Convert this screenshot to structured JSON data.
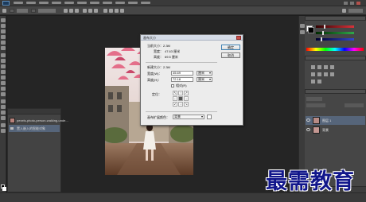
{
  "menubar": {
    "app_icon": "photoshop-logo-icon",
    "menu_count": 11
  },
  "dialog": {
    "title": "画布大小",
    "current_size_label": "当前大小：2.3M",
    "current_width_label": "宽度：",
    "current_width_value": "47.63 厘米",
    "current_height_label": "高度：",
    "current_height_value": "69.5 厘米",
    "new_size_label": "新建大小：2.3M",
    "width_label": "宽度(W)：",
    "width_value": "45.69",
    "width_unit": "厘米",
    "height_label": "高度(H)：",
    "height_value": "72.18",
    "height_unit": "厘米",
    "relative_label": "相对(R)",
    "anchor_label": "定位：",
    "extension_color_label": "画布扩展颜色：",
    "extension_color_value": "背景",
    "ok_label": "确定",
    "cancel_label": "取消"
  },
  "history": {
    "items": [
      {
        "label": "pexels-photo-person-walking-unde..."
      },
      {
        "label": "置入嵌入的智能对象"
      }
    ]
  },
  "layers": {
    "items": [
      {
        "name": "图层 1"
      },
      {
        "name": "背景"
      }
    ]
  },
  "watermark": {
    "text": "最需教育"
  },
  "colors": {
    "accent_red": "#d9323a",
    "accent_green": "#2fa84a",
    "accent_blue": "#3346c8",
    "watermark": "#11168b"
  }
}
